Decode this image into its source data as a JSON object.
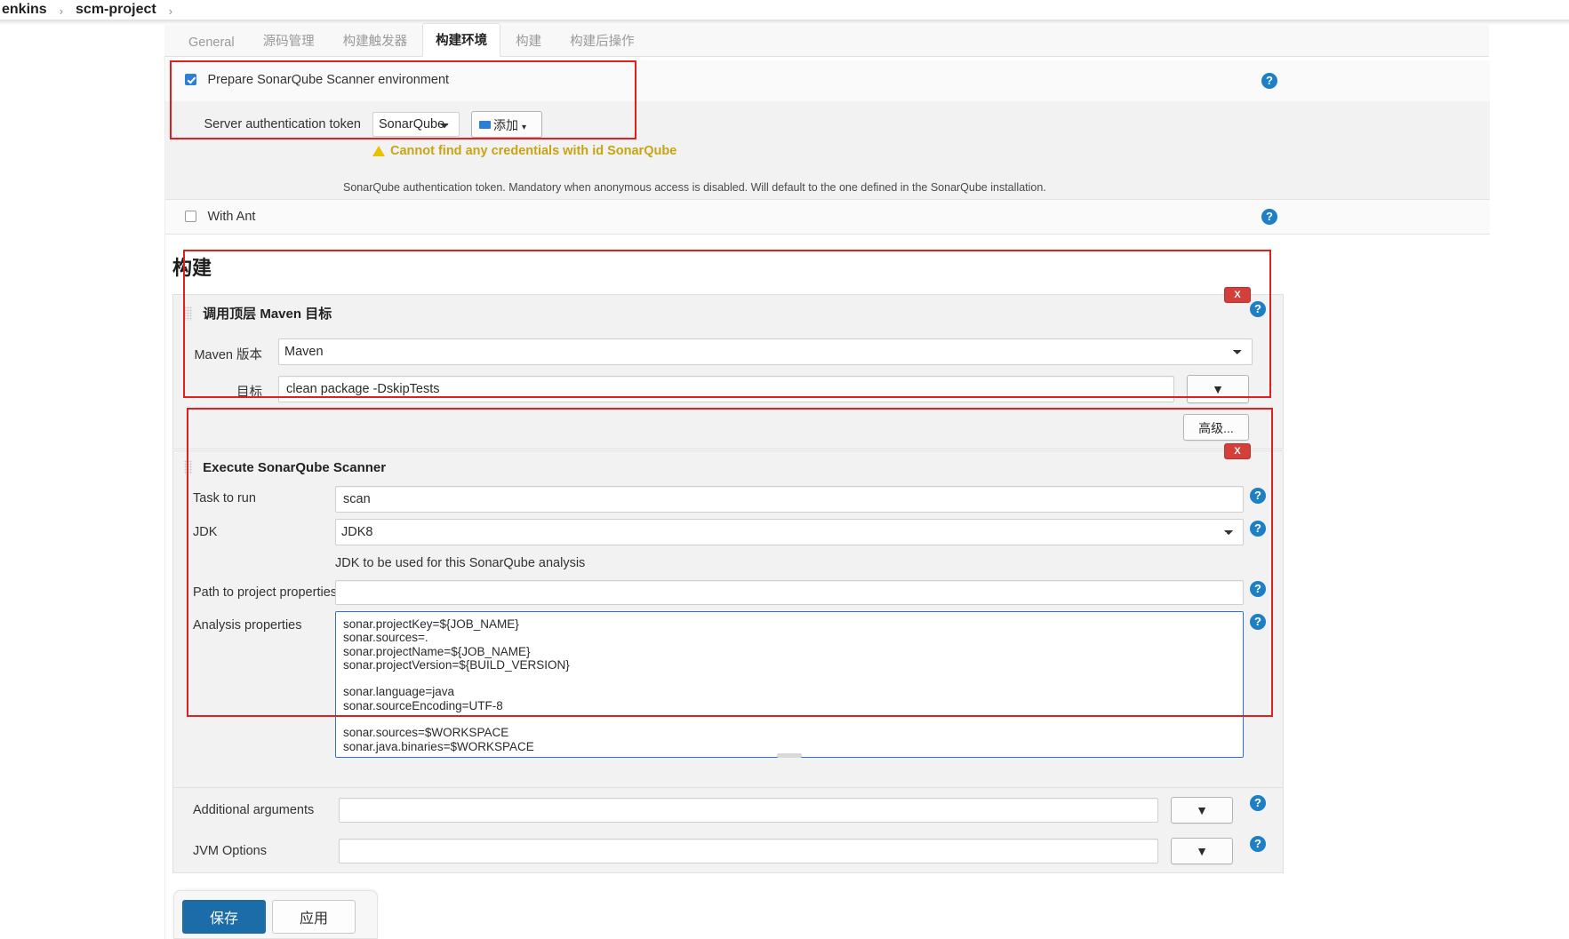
{
  "breadcrumb": {
    "items": [
      "enkins",
      "scm-project"
    ],
    "separator": "›",
    "trailing_separator": "›"
  },
  "tabs": [
    {
      "label": "General",
      "active": false
    },
    {
      "label": "源码管理",
      "active": false
    },
    {
      "label": "构建触发器",
      "active": false
    },
    {
      "label": "构建环境",
      "active": true
    },
    {
      "label": "构建",
      "active": false
    },
    {
      "label": "构建后操作",
      "active": false
    }
  ],
  "build_env": {
    "sonar_prepare": {
      "checkbox_label": "Prepare SonarQube Scanner environment",
      "checked": true,
      "token_label": "Server authentication token",
      "token_value": "SonarQube",
      "token_options": [
        "SonarQube"
      ],
      "add_button_label": "添加",
      "add_button_caret": "▾",
      "warning": "Cannot find any credentials with id SonarQube",
      "hint": "SonarQube authentication token. Mandatory when anonymous access is disabled. Will default to the one defined in the SonarQube installation."
    },
    "with_ant": {
      "checkbox_label": "With Ant",
      "checked": false
    }
  },
  "build_section": {
    "title": "构建",
    "maven": {
      "header": "调用顶层 Maven 目标",
      "version_label": "Maven 版本",
      "version_value": "Maven",
      "version_options": [
        "Maven"
      ],
      "goals_label": "目标",
      "goals_value": "clean package -DskipTests",
      "goals_dropdown_caret": "▼",
      "advanced_button": "高级...",
      "close_button": "X"
    },
    "sonar_scanner": {
      "header": "Execute SonarQube Scanner",
      "close_button": "X",
      "task_label": "Task to run",
      "task_value": "scan",
      "jdk_label": "JDK",
      "jdk_value": "JDK8",
      "jdk_options": [
        "JDK8"
      ],
      "jdk_hint": "JDK to be used for this SonarQube analysis",
      "path_label": "Path to project properties",
      "path_value": "",
      "analysis_label": "Analysis properties",
      "analysis_value": "sonar.projectKey=${JOB_NAME}\nsonar.sources=.\nsonar.projectName=${JOB_NAME}\nsonar.projectVersion=${BUILD_VERSION}\n\nsonar.language=java\nsonar.sourceEncoding=UTF-8\n\nsonar.sources=$WORKSPACE\nsonar.java.binaries=$WORKSPACE",
      "additional_args_label": "Additional arguments",
      "additional_args_value": "",
      "additional_args_caret": "▼",
      "jvm_options_label": "JVM Options",
      "jvm_options_value": "",
      "jvm_options_caret": "▼"
    }
  },
  "footer": {
    "save_label": "保存",
    "apply_label": "应用"
  },
  "icons": {
    "help": "?"
  },
  "colors": {
    "accent_blue": "#1d7fc4",
    "save_blue": "#1b6ca8",
    "highlight_red": "#e02020",
    "warning_yellow": "#c8a415",
    "delete_red": "#d43f3a"
  }
}
